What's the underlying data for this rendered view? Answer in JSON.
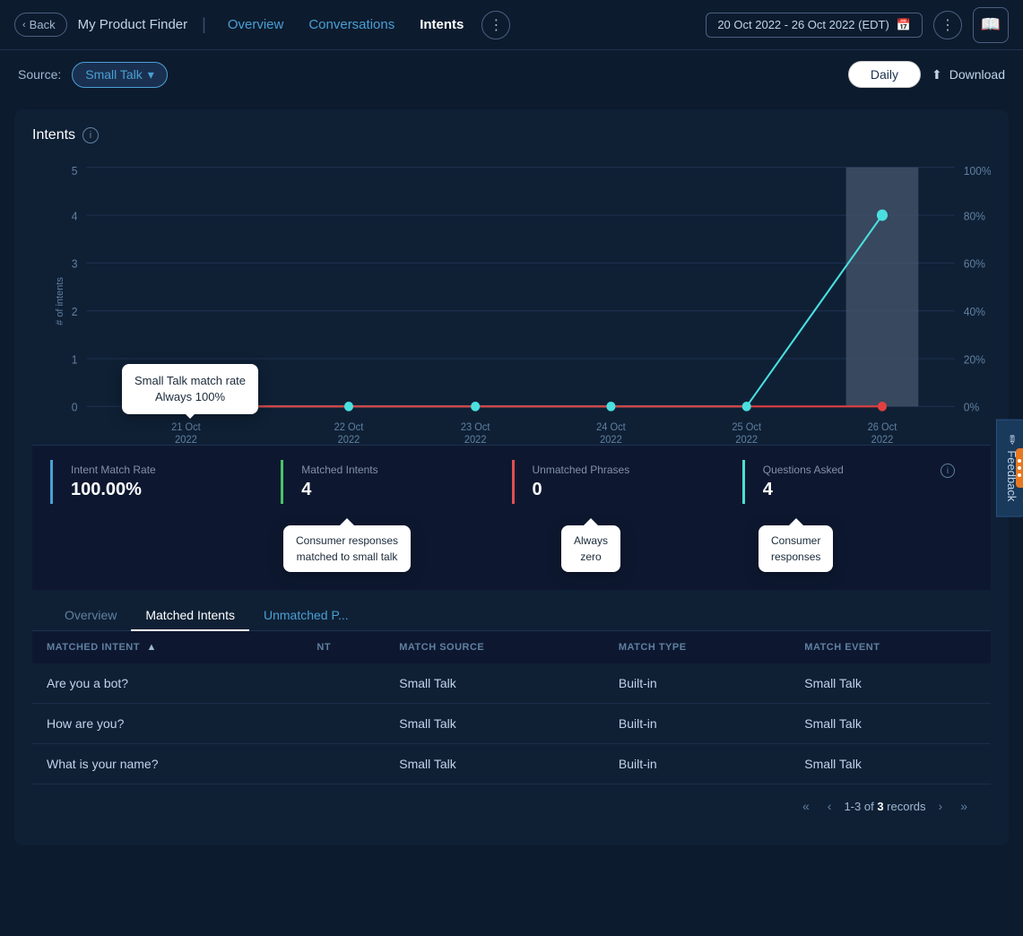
{
  "header": {
    "back_label": "Back",
    "app_title": "My Product Finder",
    "divider": "|",
    "nav_overview": "Overview",
    "nav_conversations": "Conversations",
    "nav_intents": "Intents",
    "date_range": "20 Oct 2022 - 26 Oct 2022 (EDT)",
    "calendar_icon": "📅",
    "more_icon": "⋮",
    "book_icon": "📖"
  },
  "source_bar": {
    "source_label": "Source:",
    "source_value": "Small Talk",
    "dropdown_arrow": "▾",
    "daily_label": "Daily",
    "download_label": "Download",
    "download_icon": "⬆"
  },
  "chart": {
    "title": "Intents",
    "info_icon": "i",
    "y_axis_label": "# of intents",
    "y_ticks": [
      "0",
      "1",
      "2",
      "3",
      "4",
      "5"
    ],
    "y_right_ticks": [
      "0%",
      "20%",
      "40%",
      "60%",
      "80%",
      "100%"
    ],
    "x_labels": [
      "21 Oct\n2022",
      "22 Oct\n2022",
      "23 Oct\n2022",
      "24 Oct\n2022",
      "25 Oct\n2022",
      "26 Oct\n2022"
    ],
    "tooltip": {
      "line1": "Small Talk match rate",
      "line2": "Always 100%"
    }
  },
  "stats": {
    "intent_match_rate": {
      "label": "Intent Match Rate",
      "value": "100.00%",
      "border_color": "blue"
    },
    "matched_intents": {
      "label": "Matched Intents",
      "value": "4",
      "border_color": "green"
    },
    "unmatched_phrases": {
      "label": "Unmatched Phrases",
      "value": "0",
      "border_color": "red"
    },
    "questions_asked": {
      "label": "Questions Asked",
      "value": "4",
      "border_color": "cyan",
      "has_info": true
    }
  },
  "tooltips": {
    "matched_intents_tooltip": {
      "line1": "Consumer responses",
      "line2": "matched to small talk"
    },
    "unmatched_tooltip": {
      "line1": "Always",
      "line2": "zero"
    },
    "questions_tooltip": {
      "line1": "Consumer",
      "line2": "responses"
    }
  },
  "tabs": {
    "overview": "Overview",
    "matched_intents": "Matched Intents",
    "unmatched": "Unmatched P..."
  },
  "table": {
    "columns": [
      {
        "key": "matched_intent",
        "label": "MATCHED INTENT",
        "sortable": true,
        "sort_dir": "asc"
      },
      {
        "key": "nt",
        "label": "NT",
        "sortable": false
      },
      {
        "key": "match_source",
        "label": "MATCH SOURCE",
        "sortable": false
      },
      {
        "key": "match_type",
        "label": "MATCH TYPE",
        "sortable": false
      },
      {
        "key": "match_event",
        "label": "MATCH EVENT",
        "sortable": false
      }
    ],
    "rows": [
      {
        "matched_intent": "Are you a bot?",
        "nt": "",
        "match_source": "Small Talk",
        "match_type": "Built-in",
        "match_event": "Small Talk"
      },
      {
        "matched_intent": "How are you?",
        "nt": "",
        "match_source": "Small Talk",
        "match_type": "Built-in",
        "match_event": "Small Talk"
      },
      {
        "matched_intent": "What is your name?",
        "nt": "",
        "match_source": "Small Talk",
        "match_type": "Built-in",
        "match_event": "Small Talk"
      }
    ]
  },
  "pagination": {
    "first_icon": "«",
    "prev_icon": "‹",
    "range": "1-3",
    "of_label": "of",
    "total": "3",
    "records_label": "records",
    "next_icon": "›",
    "last_icon": "»"
  },
  "feedback": {
    "label": "Feedback"
  },
  "accent_dots": [
    "",
    "",
    ""
  ]
}
